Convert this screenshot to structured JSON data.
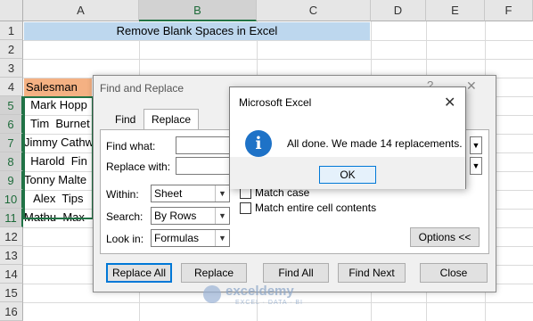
{
  "columns": [
    "A",
    "B",
    "C",
    "D",
    "E",
    "F"
  ],
  "rows": [
    "1",
    "2",
    "3",
    "4",
    "5",
    "6",
    "7",
    "8",
    "9",
    "10",
    "11",
    "12",
    "13",
    "14",
    "15",
    "16"
  ],
  "sheet": {
    "title": "Remove Blank Spaces in Excel",
    "header": "Salesman",
    "names": [
      "  Mark Hopp",
      "  Tim  Burnet",
      "Jimmy Cathw",
      "  Harold  Fin",
      "Tonny Malte",
      "   Alex  Tips",
      "Mathu  Max"
    ]
  },
  "find_replace": {
    "title": "Find and Replace",
    "help_glyph": "?",
    "close_glyph": "✕",
    "tab_find": "Find",
    "tab_replace": "Replace",
    "find_what_label": "Find what:",
    "replace_with_label": "Replace with:",
    "within_label": "Within:",
    "within_value": "Sheet",
    "search_label": "Search:",
    "search_value": "By Rows",
    "look_in_label": "Look in:",
    "look_in_value": "Formulas",
    "match_case_label": "Match case",
    "match_entire_label": "Match entire cell contents",
    "options_button": "Options <<",
    "replace_all_button": "Replace All",
    "replace_button": "Replace",
    "find_all_button": "Find All",
    "find_next_button": "Find Next",
    "close_button": "Close",
    "dropdown_glyph": "▼"
  },
  "message_box": {
    "title": "Microsoft Excel",
    "close_glyph": "✕",
    "icon_glyph": "i",
    "message": "All done. We made 14 replacements.",
    "ok_button": "OK"
  },
  "watermark": {
    "name": "exceldemy",
    "tagline": "EXCEL · DATA · BI"
  },
  "colors": {
    "title_fill": "#bdd7ee",
    "header_fill": "#f4b183",
    "selection": "#217346",
    "info_icon": "#1e72c7",
    "focus_border": "#0078d7"
  }
}
